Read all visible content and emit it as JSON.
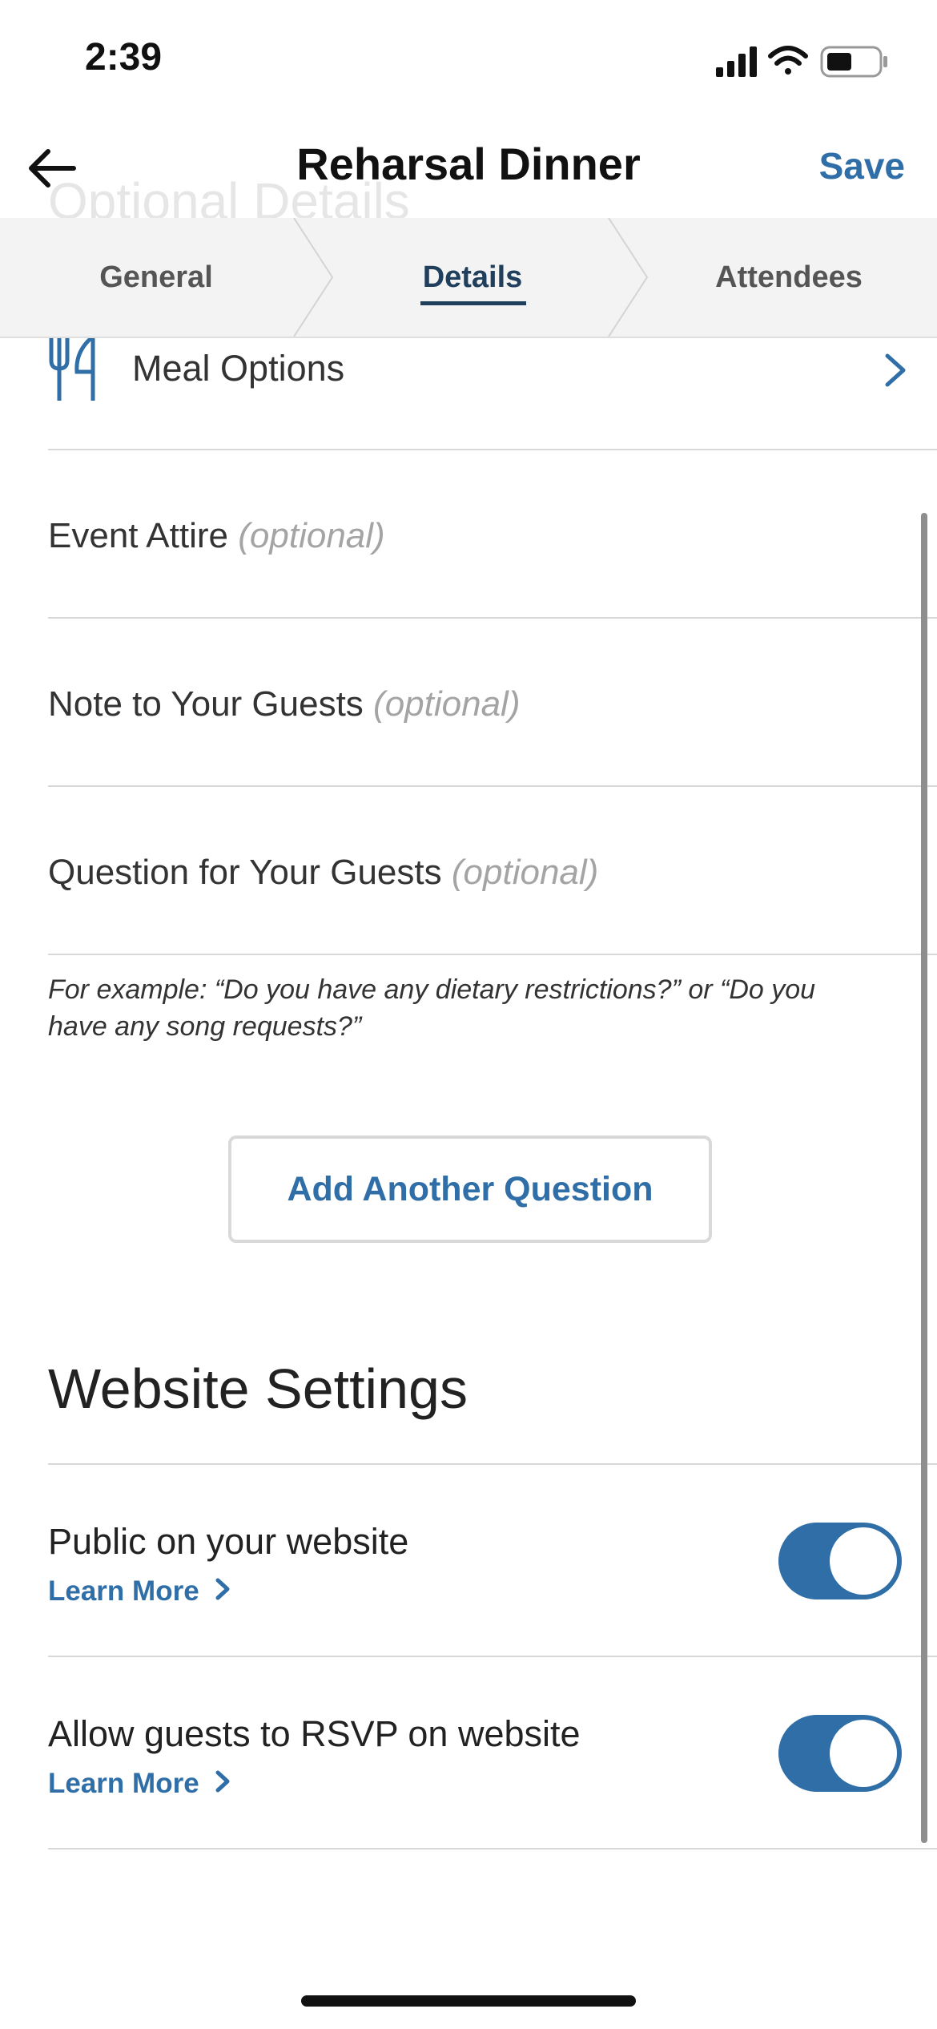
{
  "status_bar": {
    "time": "2:39",
    "icons": [
      "signal-icon",
      "wifi-icon",
      "battery-icon"
    ]
  },
  "nav": {
    "back_icon": "back-arrow-icon",
    "title": "Reharsal Dinner",
    "save_label": "Save"
  },
  "ghost_heading": "Optional Details",
  "tabs": [
    {
      "label": "General",
      "active": false
    },
    {
      "label": "Details",
      "active": true
    },
    {
      "label": "Attendees",
      "active": false
    }
  ],
  "meal_options": {
    "icon": "fork-knife-icon",
    "label": "Meal Options",
    "arrow_icon": "chevron-right-icon"
  },
  "fields": [
    {
      "label": "Event Attire",
      "optional": "(optional)"
    },
    {
      "label": "Note to Your Guests",
      "optional": "(optional)"
    },
    {
      "label": "Question for Your Guests",
      "optional": "(optional)"
    }
  ],
  "helper_text": "For example: “Do you have any dietary restrictions?” or “Do you have any song requests?”",
  "add_question_label": "Add Another Question",
  "website_settings": {
    "title": "Website Settings",
    "settings": [
      {
        "label": "Public on your website",
        "learn_more": "Learn More",
        "enabled": true
      },
      {
        "label": "Allow guests to RSVP on website",
        "learn_more": "Learn More",
        "enabled": true
      }
    ]
  },
  "colors": {
    "accent": "#2f6ea6",
    "active_tab": "#1f3f5c",
    "divider": "#d8d8d8",
    "tab_bar_bg": "#f3f3f3"
  }
}
